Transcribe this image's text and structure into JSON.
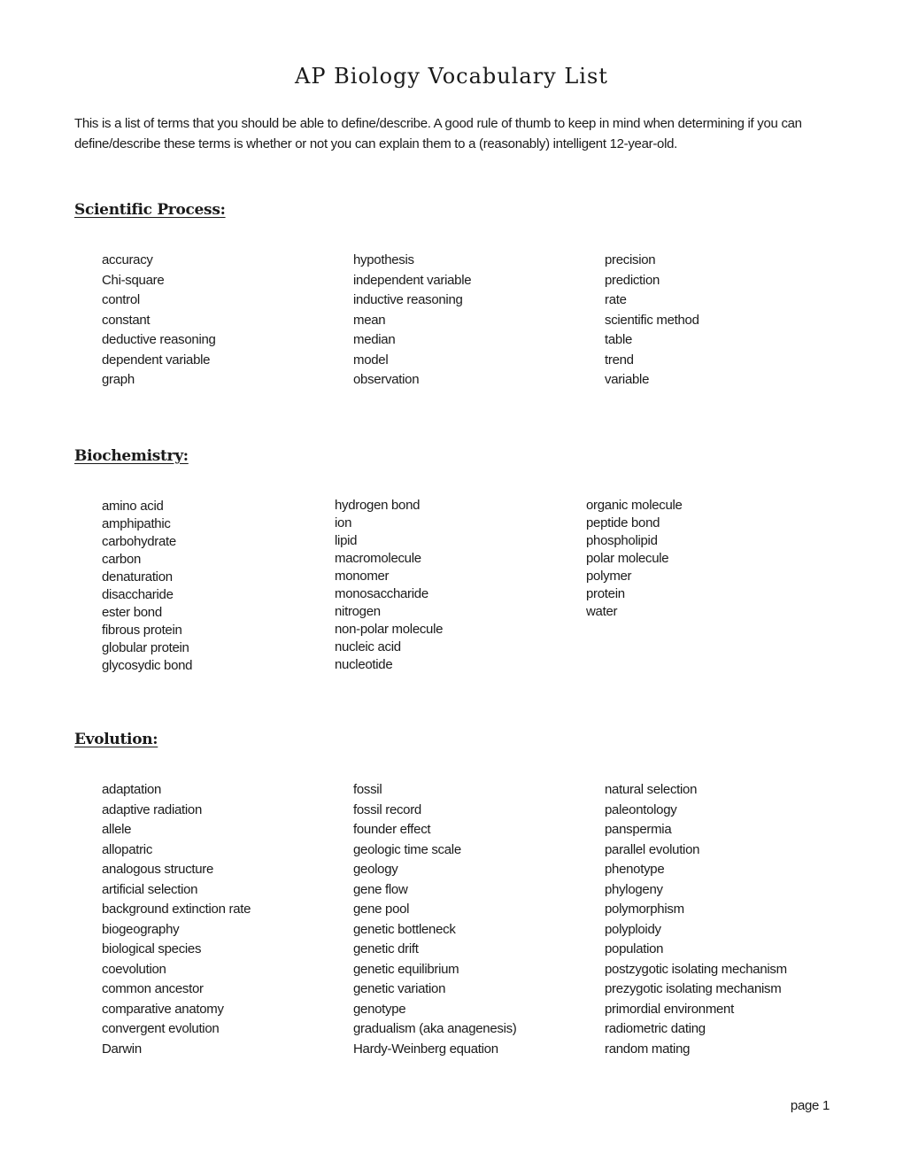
{
  "document": {
    "title": "AP Biology Vocabulary List",
    "intro": "This is a list of terms that you should be able to define/describe.  A good rule of thumb to keep in mind when determining if you can define/describe these terms is whether or not you can explain them to a (reasonably) intelligent 12-year-old.",
    "page_label": "page 1"
  },
  "sections": {
    "scientific_process": {
      "heading": "Scientific Process:",
      "columns": [
        [
          "accuracy",
          "Chi-square",
          "control",
          "constant",
          "deductive reasoning",
          "dependent variable",
          "graph"
        ],
        [
          "hypothesis",
          "independent variable",
          "inductive reasoning",
          "mean",
          "median",
          "model",
          "observation"
        ],
        [
          "precision",
          "prediction",
          "rate",
          "scientific method",
          "table",
          "trend",
          "variable"
        ]
      ]
    },
    "biochemistry": {
      "heading": "Biochemistry:",
      "columns": [
        [
          "amino acid",
          "amphipathic",
          "carbohydrate",
          "carbon",
          "denaturation",
          "disaccharide",
          "ester bond",
          "fibrous protein",
          "globular protein",
          "glycosydic bond"
        ],
        [
          "hydrogen bond",
          "ion",
          "lipid",
          "macromolecule",
          "monomer",
          "monosaccharide",
          "nitrogen",
          "non-polar molecule",
          "nucleic acid",
          "nucleotide"
        ],
        [
          "organic molecule",
          "peptide bond",
          "phospholipid",
          "polar molecule",
          "polymer",
          "protein",
          "water"
        ]
      ]
    },
    "evolution": {
      "heading": "Evolution:",
      "columns": [
        [
          "adaptation",
          "adaptive radiation",
          "allele",
          "allopatric",
          "analogous structure",
          "artificial selection",
          "background extinction rate",
          "biogeography",
          "biological species",
          "coevolution",
          "common ancestor",
          "comparative anatomy",
          "convergent evolution",
          "Darwin"
        ],
        [
          "fossil",
          "fossil record",
          "founder effect",
          "geologic time scale",
          "geology",
          "gene flow",
          "gene pool",
          "genetic bottleneck",
          "genetic drift",
          "genetic equilibrium",
          "genetic variation",
          "genotype",
          "gradualism (aka anagenesis)",
          "Hardy-Weinberg equation"
        ],
        [
          "natural selection",
          "paleontology",
          "panspermia",
          "parallel evolution",
          "phenotype",
          "phylogeny",
          "polymorphism",
          "polyploidy",
          "population",
          "postzygotic isolating mechanism",
          "prezygotic isolating mechanism",
          "primordial environment",
          "radiometric dating",
          "random mating"
        ]
      ]
    }
  }
}
